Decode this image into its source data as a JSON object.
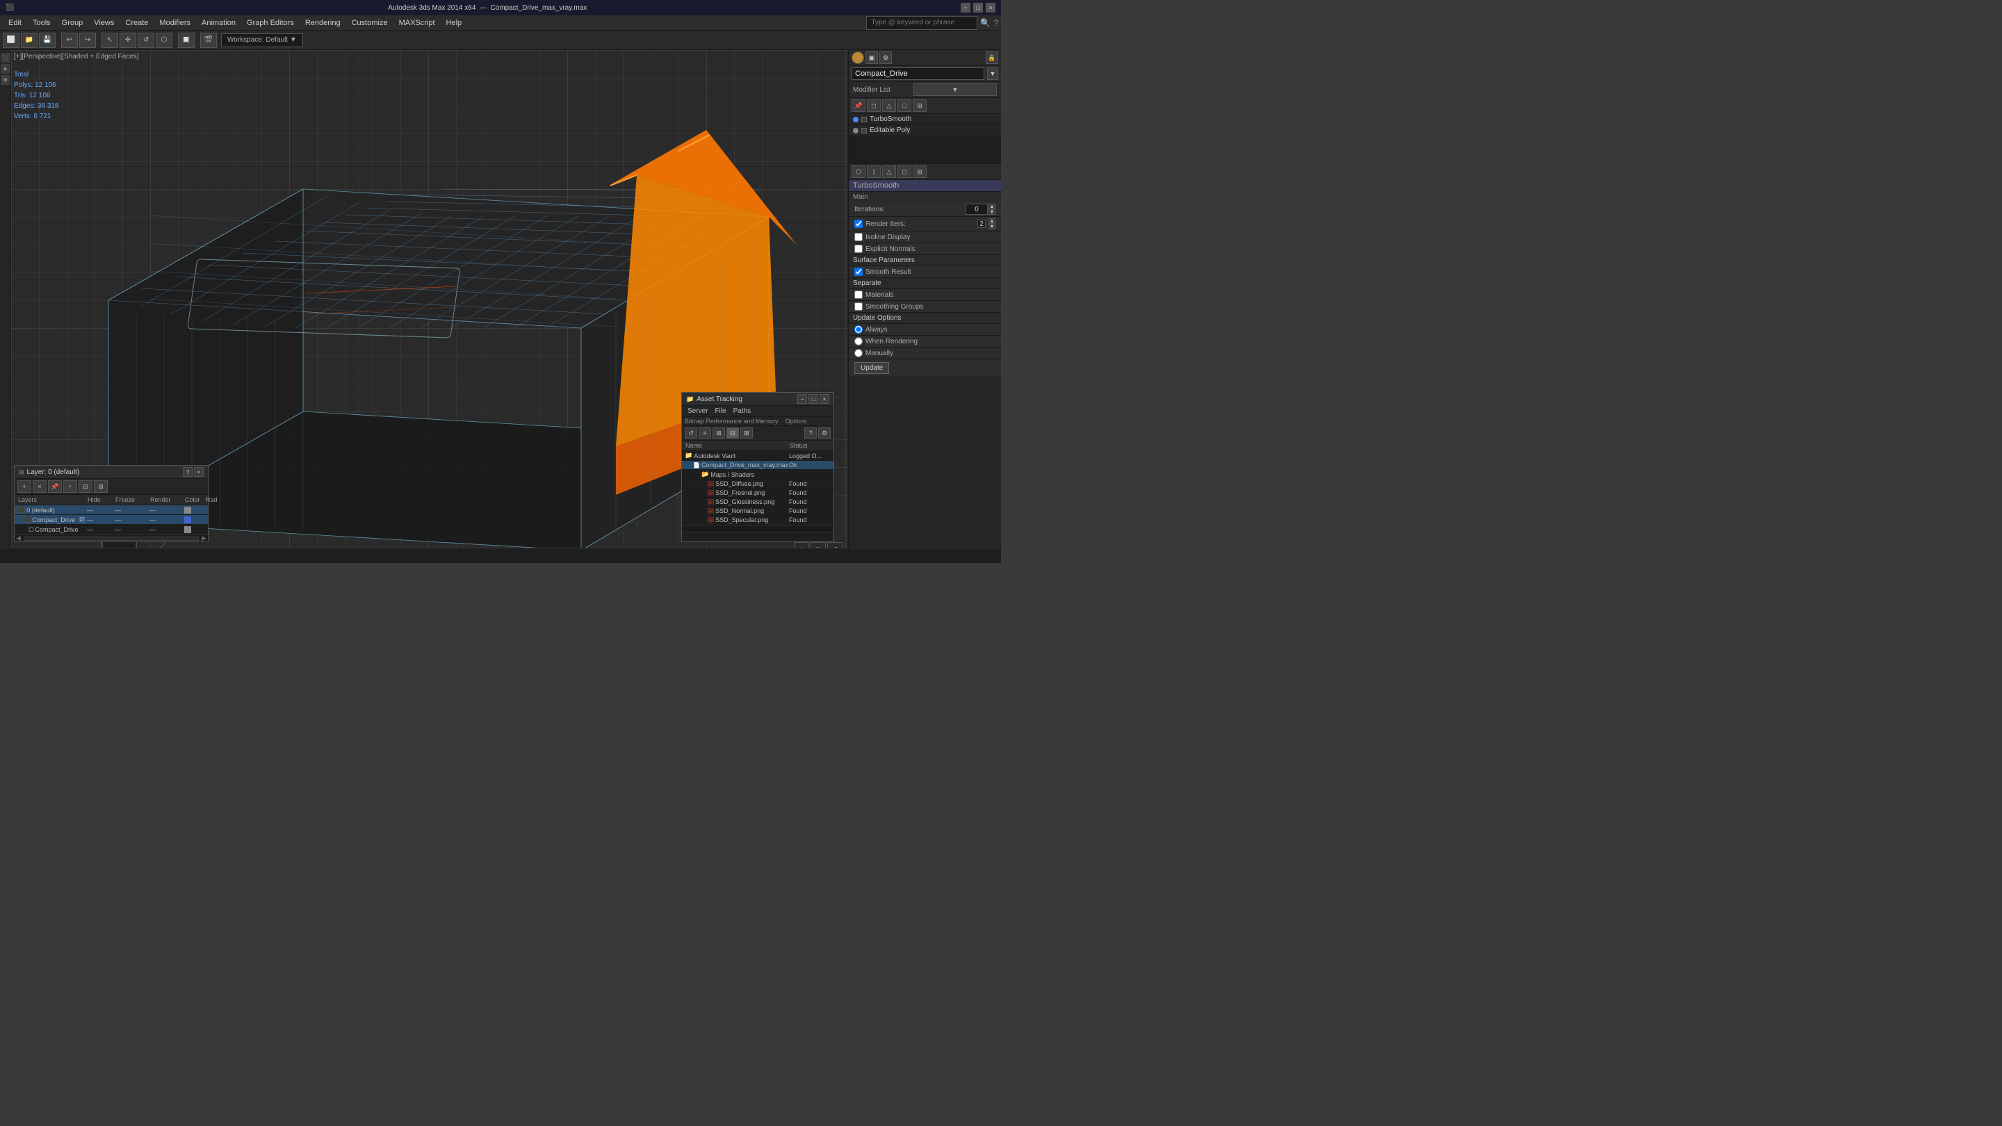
{
  "titlebar": {
    "app": "Autodesk 3ds Max 2014 x64",
    "file": "Compact_Drive_max_vray.max",
    "minimize": "−",
    "maximize": "□",
    "close": "×"
  },
  "search": {
    "placeholder": "Type @ keyword or phrase"
  },
  "menubar": {
    "items": [
      "Edit",
      "Tools",
      "Group",
      "Views",
      "Create",
      "Modifiers",
      "Animation",
      "Graph Editors",
      "Rendering",
      "Customize",
      "MAXScript",
      "Help"
    ]
  },
  "viewport": {
    "label": "[+][Perspective][Shaded + Edged Faces]"
  },
  "stats": {
    "polys_label": "Polys:",
    "polys_val": "12 106",
    "tris_label": "Tris:",
    "tris_val": "12 106",
    "edges_label": "Edges:",
    "edges_val": "36 318",
    "verts_label": "Verts:",
    "verts_val": "6 721",
    "total": "Total"
  },
  "right_panel": {
    "object_name": "Compact_Drive",
    "modifier_list_label": "Modifier List",
    "modifier_icons": [
      "pin",
      "rect",
      "tri",
      "sq",
      "grid"
    ],
    "modifiers": [
      {
        "name": "TurboSmooth",
        "light": "blue",
        "type": "turbosmooth"
      },
      {
        "name": "Editable Poly",
        "light": "gray",
        "type": "editpoly"
      }
    ],
    "turbosmooth": {
      "title": "TurboSmooth",
      "main_label": "Main",
      "iterations_label": "Iterations:",
      "iterations_val": "0",
      "render_iters_label": "Render Iters:",
      "render_iters_val": "2",
      "isoline_label": "Isoline Display",
      "explicit_normals_label": "Explicit Normals",
      "surface_params_label": "Surface Parameters",
      "smooth_result_label": "Smooth Result",
      "smooth_result_checked": true,
      "separate_label": "Separate",
      "materials_label": "Materials",
      "smoothing_groups_label": "Smoothing Groups",
      "update_options_label": "Update Options",
      "always_label": "Always",
      "when_rendering_label": "When Rendering",
      "manually_label": "Manually",
      "update_btn": "Update"
    }
  },
  "layers_panel": {
    "title": "Layer: 0 (default)",
    "question": "?",
    "close": "×",
    "toolbar": [
      "plus",
      "x",
      "pin",
      "move",
      "fold",
      "unfold"
    ],
    "columns": [
      "Layers",
      "Hide",
      "Freeze",
      "Render",
      "Color",
      "Rad"
    ],
    "rows": [
      {
        "name": "0 (default)",
        "hide": "-",
        "freeze": "-",
        "render": "-",
        "color": "gray",
        "rad": "",
        "indent": 0,
        "selected": true
      },
      {
        "name": "Compact_Drive",
        "hide": "-",
        "freeze": "-",
        "render": "-",
        "color": "blue",
        "rad": "",
        "indent": 1,
        "selected": true
      },
      {
        "name": "Compact_Drive",
        "hide": "-",
        "freeze": "-",
        "render": "-",
        "color": "gray",
        "rad": "",
        "indent": 2,
        "selected": false
      }
    ]
  },
  "asset_tracking": {
    "title": "Asset Tracking",
    "menus": [
      "Server",
      "File",
      "Paths",
      "Bitmap Performance and Memory",
      "Options"
    ],
    "toolbar": [
      "refresh",
      "list",
      "grid",
      "detail",
      "tile",
      "select",
      "help"
    ],
    "columns": [
      "Name",
      "Status"
    ],
    "rows": [
      {
        "name": "Autodesk Vault",
        "status": "Logged O..",
        "indent": 0,
        "icon": "vault",
        "selected": false
      },
      {
        "name": "Compact_Drive_max_vray.max",
        "status": "Ok",
        "indent": 1,
        "icon": "file",
        "selected": true
      },
      {
        "name": "Maps / Shaders",
        "status": "",
        "indent": 2,
        "icon": "folder",
        "selected": false
      },
      {
        "name": "SSD_Diffuse.png",
        "status": "Found",
        "indent": 3,
        "icon": "image",
        "selected": false
      },
      {
        "name": "SSD_Fresnel.png",
        "status": "Found",
        "indent": 3,
        "icon": "image",
        "selected": false
      },
      {
        "name": "SSD_Glossiness.png",
        "status": "Found",
        "indent": 3,
        "icon": "image",
        "selected": false
      },
      {
        "name": "SSD_Normal.png",
        "status": "Found",
        "indent": 3,
        "icon": "image",
        "selected": false
      },
      {
        "name": "SSD_Specular.png",
        "status": "Found",
        "indent": 3,
        "icon": "image",
        "selected": false
      }
    ]
  },
  "statusbar": {
    "text": ""
  }
}
